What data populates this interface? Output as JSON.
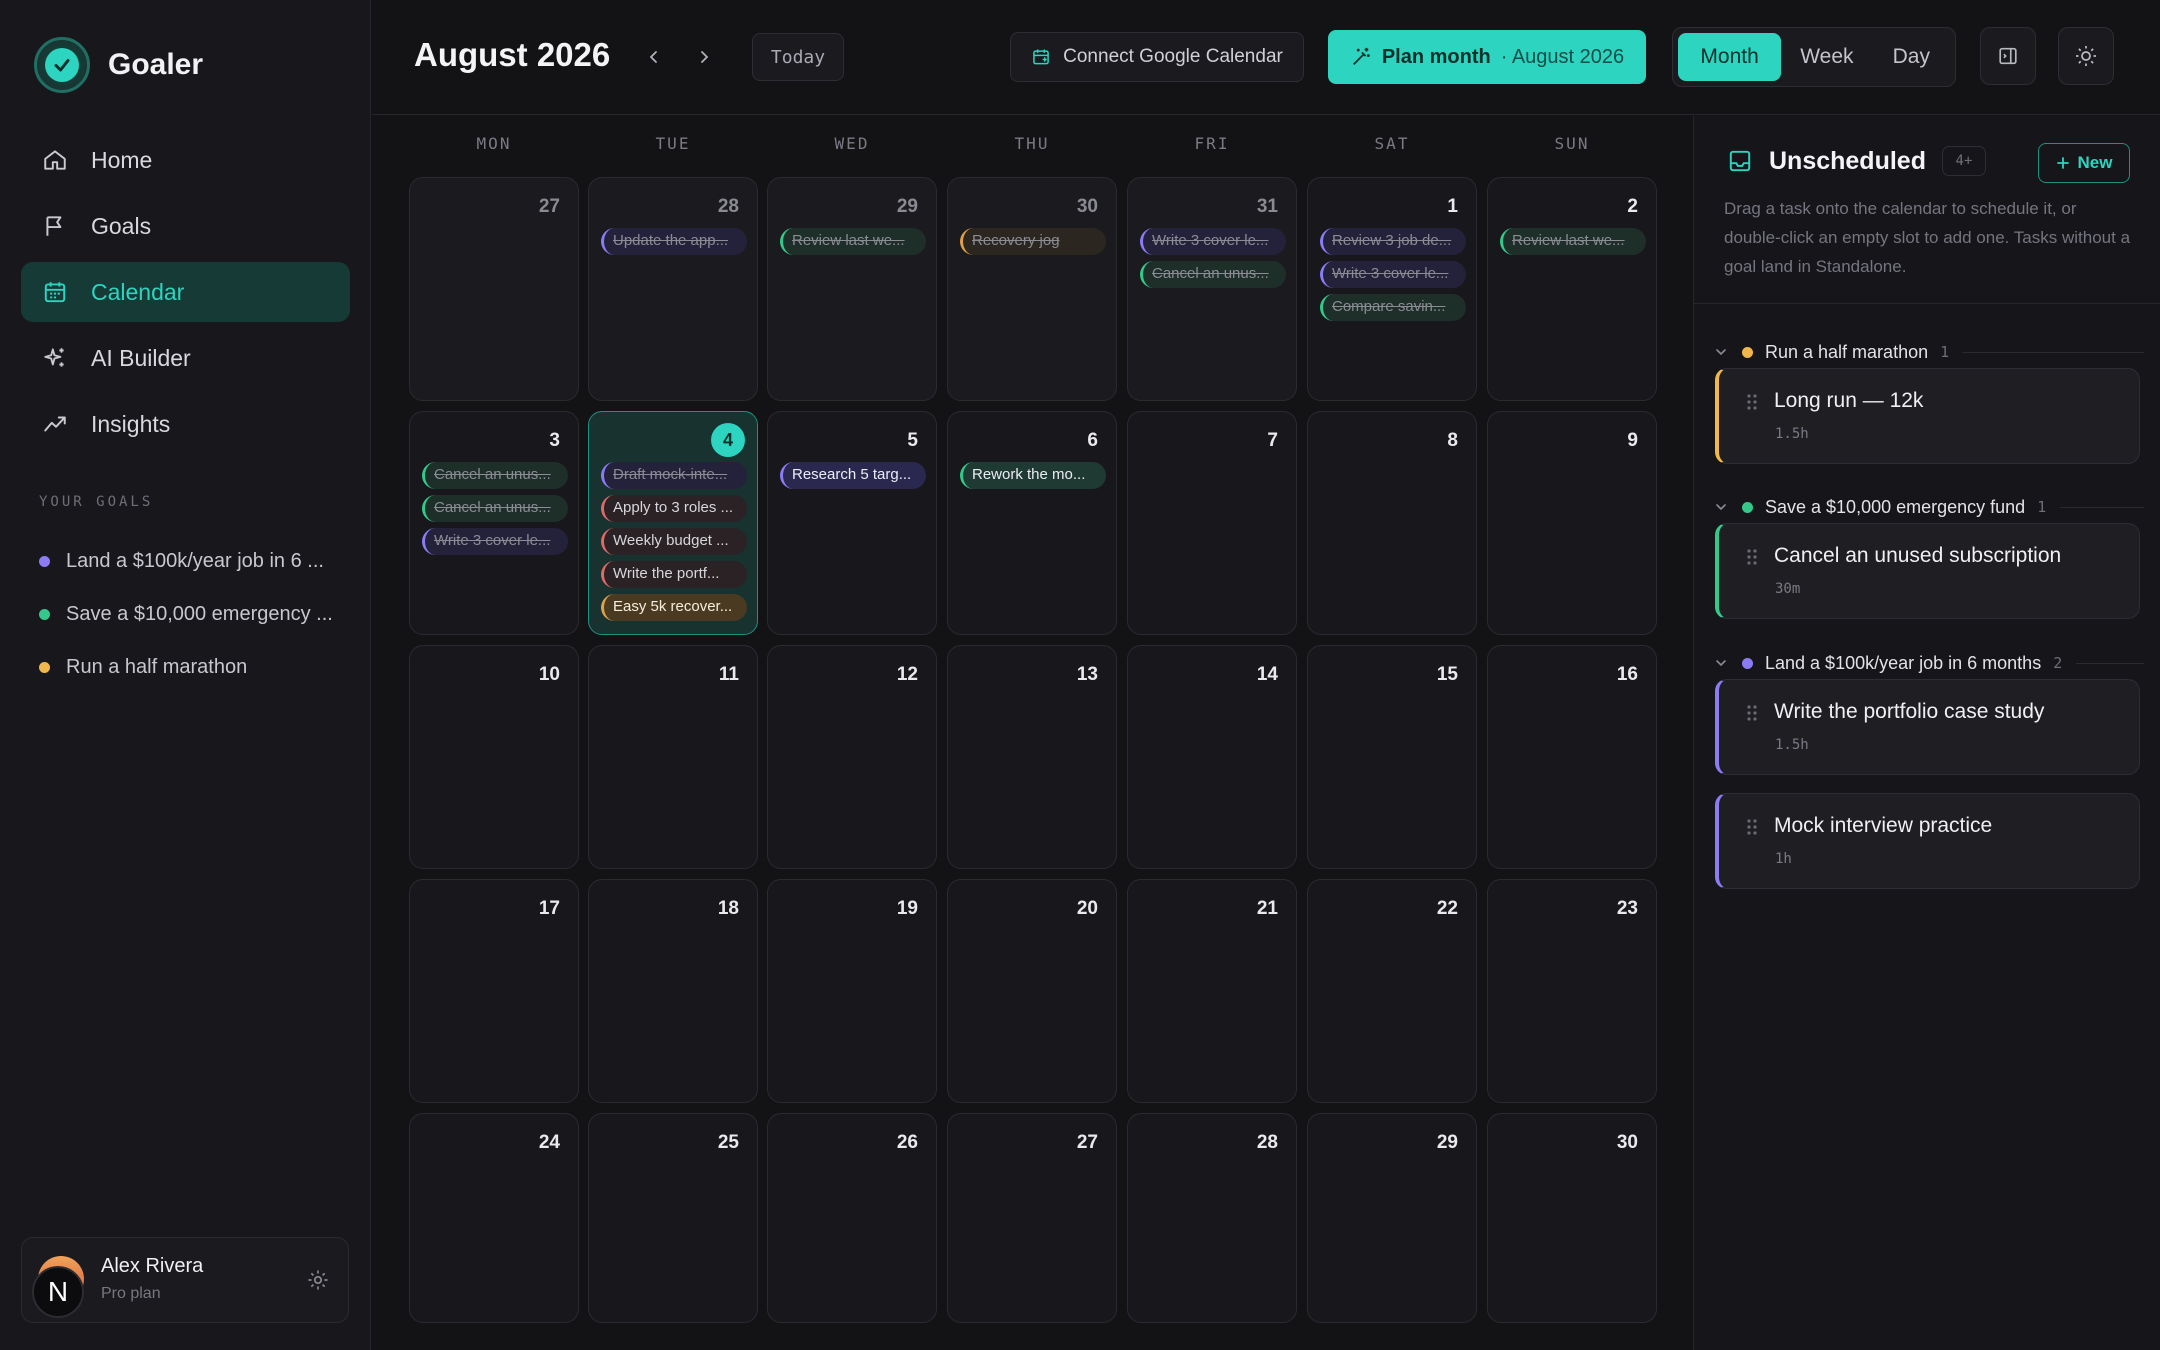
{
  "app": {
    "name": "Goaler"
  },
  "nav": {
    "items": [
      {
        "label": "Home",
        "icon": "home-icon"
      },
      {
        "label": "Goals",
        "icon": "flag-icon"
      },
      {
        "label": "Calendar",
        "icon": "calendar-icon",
        "active": true
      },
      {
        "label": "AI Builder",
        "icon": "sparkles-icon"
      },
      {
        "label": "Insights",
        "icon": "trend-icon"
      }
    ]
  },
  "goals_section": {
    "label": "YOUR GOALS",
    "items": [
      {
        "label": "Land a $100k/year job in 6 ...",
        "color": "#8b7cf6"
      },
      {
        "label": "Save a $10,000 emergency ...",
        "color": "#34c98a"
      },
      {
        "label": "Run a half marathon",
        "color": "#f0b84a"
      }
    ]
  },
  "user": {
    "name": "Alex Rivera",
    "plan": "Pro plan",
    "avatar_letter": "N"
  },
  "header": {
    "month_title": "August 2026",
    "today_label": "Today",
    "gcal_label": "Connect Google Calendar",
    "plan_label": "Plan month",
    "plan_sub": "· August 2026",
    "views": [
      "Month",
      "Week",
      "Day"
    ],
    "active_view": "Month"
  },
  "calendar": {
    "weekdays": [
      "MON",
      "TUE",
      "WED",
      "THU",
      "FRI",
      "SAT",
      "SUN"
    ],
    "weeks": [
      [
        {
          "day": "27",
          "other": true,
          "tasks": []
        },
        {
          "day": "28",
          "other": true,
          "tasks": [
            {
              "label": "Update the app...",
              "color": "purple",
              "done": true
            }
          ]
        },
        {
          "day": "29",
          "other": true,
          "tasks": [
            {
              "label": "Review last we...",
              "color": "green",
              "done": true
            }
          ]
        },
        {
          "day": "30",
          "other": true,
          "tasks": [
            {
              "label": "Recovery jog",
              "color": "orange",
              "done": true
            }
          ]
        },
        {
          "day": "31",
          "other": true,
          "tasks": [
            {
              "label": "Write 3 cover le...",
              "color": "purple",
              "done": true
            },
            {
              "label": "Cancel an unus...",
              "color": "green",
              "done": true
            }
          ]
        },
        {
          "day": "1",
          "other": false,
          "tasks": [
            {
              "label": "Review 3 job de...",
              "color": "purple",
              "done": true
            },
            {
              "label": "Write 3 cover le...",
              "color": "purple",
              "done": true
            },
            {
              "label": "Compare savin...",
              "color": "green",
              "done": true
            }
          ]
        },
        {
          "day": "2",
          "other": false,
          "tasks": [
            {
              "label": "Review last we...",
              "color": "green",
              "done": true
            }
          ]
        }
      ],
      [
        {
          "day": "3",
          "tasks": [
            {
              "label": "Cancel an unus...",
              "color": "green",
              "done": true
            },
            {
              "label": "Cancel an unus...",
              "color": "green",
              "done": true
            },
            {
              "label": "Write 3 cover le...",
              "color": "purple",
              "done": true
            }
          ]
        },
        {
          "day": "4",
          "today": true,
          "tasks": [
            {
              "label": "Draft mock-inte...",
              "color": "purple",
              "done": true
            },
            {
              "label": "Apply to 3 roles ...",
              "color": "red",
              "done": false
            },
            {
              "label": "Weekly budget ...",
              "color": "red",
              "done": false
            },
            {
              "label": "Write the portf...",
              "color": "red",
              "done": false
            },
            {
              "label": "Easy 5k recover...",
              "color": "hl-orange",
              "done": false
            }
          ]
        },
        {
          "day": "5",
          "tasks": [
            {
              "label": "Research 5 targ...",
              "color": "active-purple",
              "done": false
            }
          ]
        },
        {
          "day": "6",
          "tasks": [
            {
              "label": "Rework the mo...",
              "color": "active-green",
              "done": false
            }
          ]
        },
        {
          "day": "7",
          "tasks": []
        },
        {
          "day": "8",
          "tasks": []
        },
        {
          "day": "9",
          "tasks": []
        }
      ],
      [
        {
          "day": "10",
          "tasks": []
        },
        {
          "day": "11",
          "tasks": []
        },
        {
          "day": "12",
          "tasks": []
        },
        {
          "day": "13",
          "tasks": []
        },
        {
          "day": "14",
          "tasks": []
        },
        {
          "day": "15",
          "tasks": []
        },
        {
          "day": "16",
          "tasks": []
        }
      ],
      [
        {
          "day": "17",
          "tasks": []
        },
        {
          "day": "18",
          "tasks": []
        },
        {
          "day": "19",
          "tasks": []
        },
        {
          "day": "20",
          "tasks": []
        },
        {
          "day": "21",
          "tasks": []
        },
        {
          "day": "22",
          "tasks": []
        },
        {
          "day": "23",
          "tasks": []
        }
      ],
      [
        {
          "day": "24",
          "tasks": []
        },
        {
          "day": "25",
          "tasks": []
        },
        {
          "day": "26",
          "tasks": []
        },
        {
          "day": "27",
          "tasks": []
        },
        {
          "day": "28",
          "tasks": []
        },
        {
          "day": "29",
          "tasks": []
        },
        {
          "day": "30",
          "tasks": []
        }
      ]
    ]
  },
  "unscheduled": {
    "title": "Unscheduled",
    "count": "4+",
    "new_label": "New",
    "help": "Drag a task onto the calendar to schedule it, or double-click an empty slot to add one. Tasks without a goal land in Standalone.",
    "groups": [
      {
        "name": "Run a half marathon",
        "count": "1",
        "color": "#f0b84a",
        "tasks": [
          {
            "name": "Long run — 12k",
            "duration": "1.5h"
          }
        ]
      },
      {
        "name": "Save a $10,000 emergency fund",
        "count": "1",
        "color": "#34c98a",
        "tasks": [
          {
            "name": "Cancel an unused subscription",
            "duration": "30m"
          }
        ]
      },
      {
        "name": "Land a $100k/year job in 6 months",
        "count": "2",
        "color": "#8b7cf6",
        "tasks": [
          {
            "name": "Write the portfolio case study",
            "duration": "1.5h"
          },
          {
            "name": "Mock interview practice",
            "duration": "1h"
          }
        ]
      }
    ]
  }
}
